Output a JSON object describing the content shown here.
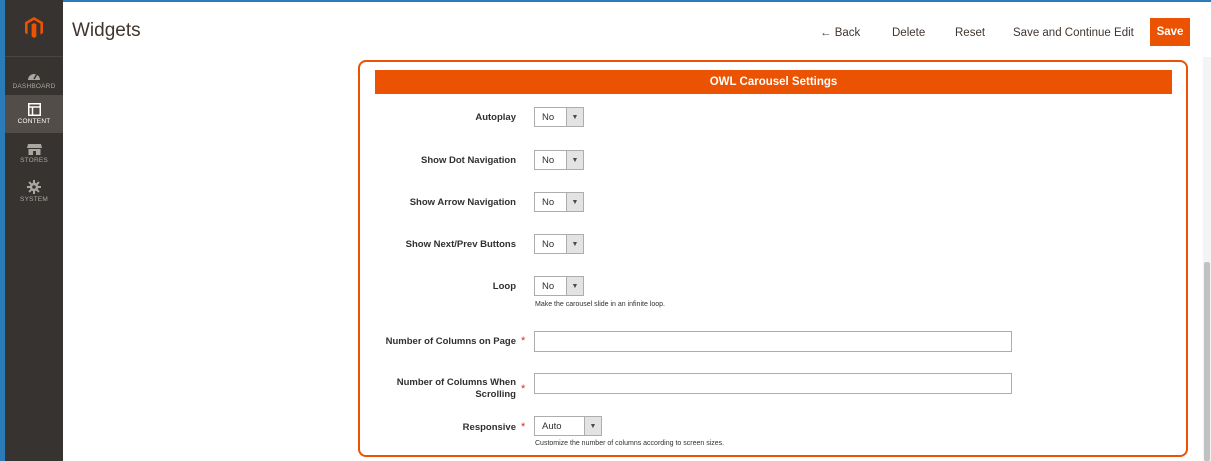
{
  "sidebar": {
    "logo_icon": "magento-logo-icon",
    "items": [
      {
        "label": "DASHBOARD",
        "icon": "dashboard-gauge-icon",
        "active": false
      },
      {
        "label": "CONTENT",
        "icon": "content-layout-icon",
        "active": true
      },
      {
        "label": "STORES",
        "icon": "stores-shop-icon",
        "active": false
      },
      {
        "label": "SYSTEM",
        "icon": "system-gear-icon",
        "active": false
      }
    ]
  },
  "header": {
    "title": "Widgets",
    "back_label": "← Back",
    "delete_label": "Delete",
    "reset_label": "Reset",
    "save_continue_label": "Save and Continue Edit",
    "save_label": "Save"
  },
  "form": {
    "section_title": "OWL Carousel Settings",
    "autoplay": {
      "label": "Autoplay",
      "value": "No"
    },
    "dot_nav": {
      "label": "Show Dot Navigation",
      "value": "No"
    },
    "arrow_nav": {
      "label": "Show Arrow Navigation",
      "value": "No"
    },
    "next_prev": {
      "label": "Show Next/Prev Buttons",
      "value": "No"
    },
    "loop": {
      "label": "Loop",
      "value": "No",
      "note": "Make the carousel slide in an infinite loop."
    },
    "cols_page": {
      "label": "Number of Columns on Page",
      "required_mark": "*",
      "value": ""
    },
    "cols_scroll": {
      "label": "Number of Columns When Scrolling",
      "required_mark": "*",
      "value": ""
    },
    "responsive": {
      "label": "Responsive",
      "required_mark": "*",
      "value": "Auto",
      "note": "Customize the number of columns according to screen sizes."
    }
  },
  "colors": {
    "accent": "#eb5202",
    "sidebar_bg": "#373330",
    "sidebar_active": "#524d49",
    "required": "#e22626"
  }
}
